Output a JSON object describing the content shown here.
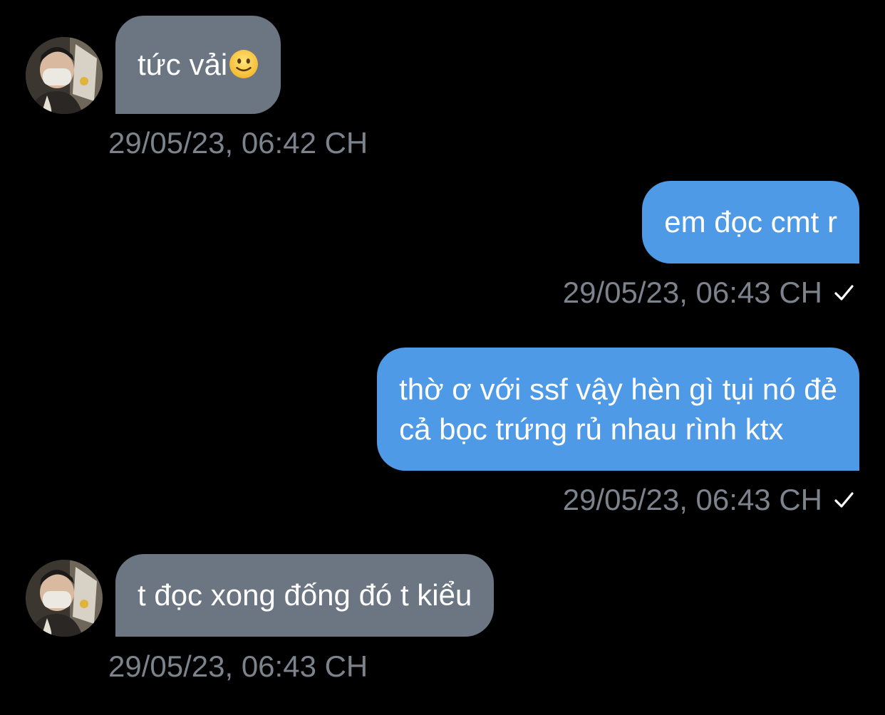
{
  "colors": {
    "background": "#000000",
    "incoming_bubble": "#6b7682",
    "outgoing_bubble": "#4f9ae6",
    "timestamp": "#7c838c"
  },
  "messages": [
    {
      "direction": "incoming",
      "text": "tức vải",
      "emoji": "slightly-smiling-face-icon",
      "timestamp": "29/05/23, 06:42 CH"
    },
    {
      "direction": "outgoing",
      "text": "em đọc cmt r",
      "timestamp": "29/05/23, 06:43 CH",
      "status": "sent-checkmark-icon"
    },
    {
      "direction": "outgoing",
      "lines": [
        "thờ ơ với ssf vậy hèn gì tụi nó đẻ",
        "cả bọc trứng rủ nhau rình ktx"
      ],
      "timestamp": "29/05/23, 06:43 CH",
      "status": "sent-checkmark-icon"
    },
    {
      "direction": "incoming",
      "text": "t đọc xong đống đó t kiểu",
      "timestamp": "29/05/23, 06:43 CH"
    }
  ]
}
